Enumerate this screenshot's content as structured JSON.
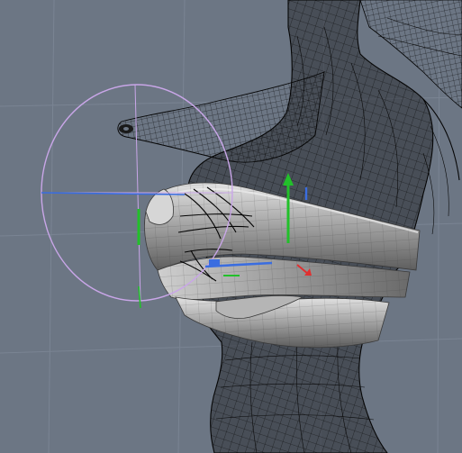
{
  "viewport": {
    "background_color": "#6c7684",
    "grid_color": "#7a8493",
    "wireframe_color": "#0a0a0a"
  },
  "mesh": {
    "surface_color": "#8c8c8c",
    "highlight_color": "#d8d8d8"
  },
  "gizmo": {
    "rotate_circle_color": "#c9a6e8",
    "axis_x_color": "#3a6de0",
    "axis_y_color": "#22c02a",
    "axis_z_color": "#e03030",
    "icons": [
      "rotate-gizmo-icon",
      "translate-gizmo-icon",
      "pivot-arrow-icon"
    ]
  }
}
